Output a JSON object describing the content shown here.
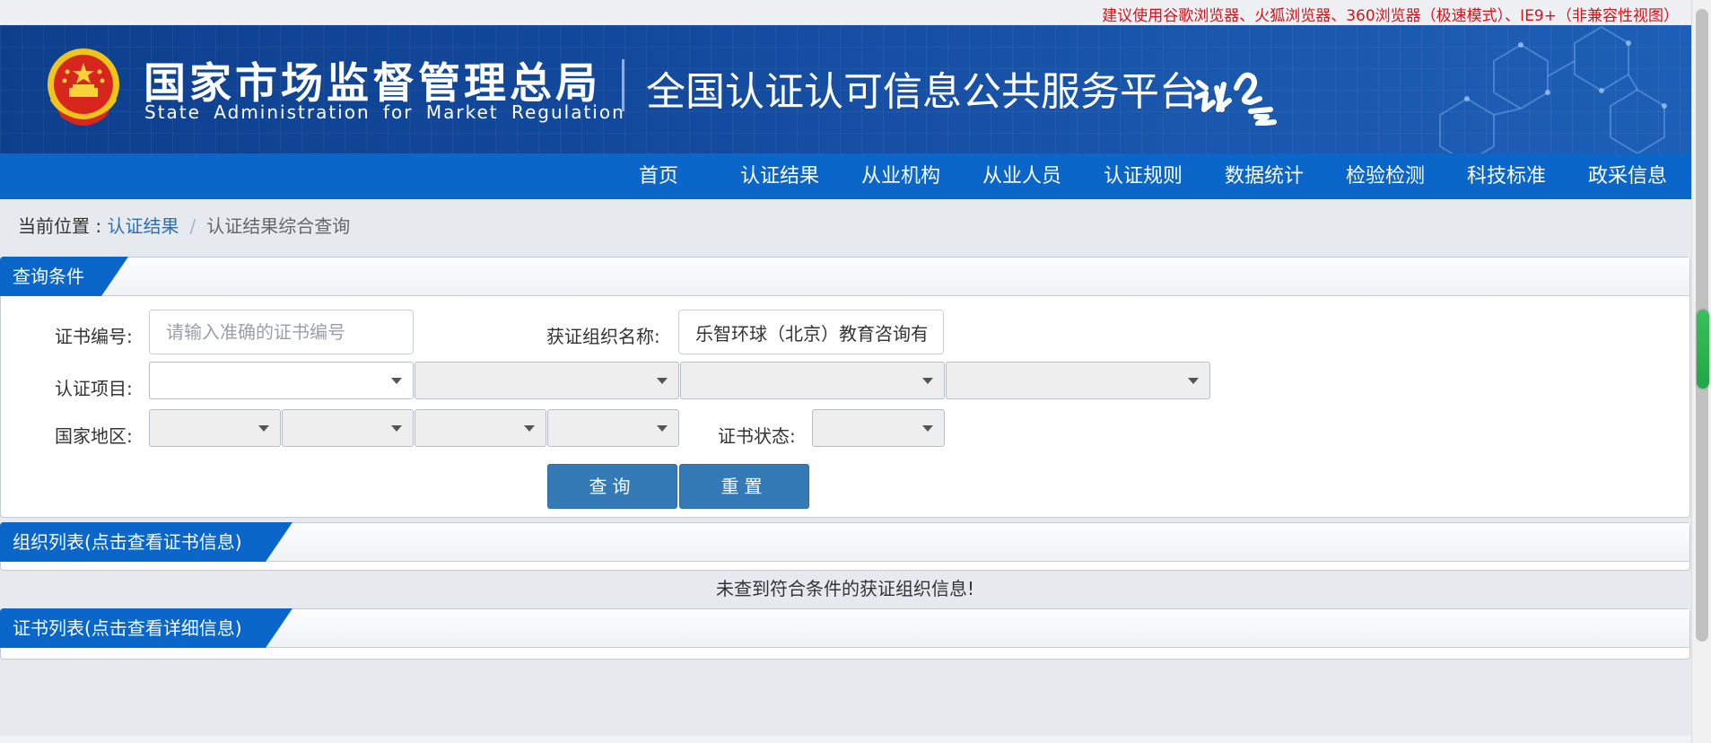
{
  "top_notice": "建议使用谷歌浏览器、火狐浏览器、360浏览器（极速模式）、IE9+（非兼容性视图）",
  "header": {
    "agency_cn": "国家市场监督管理总局",
    "agency_en": "State Administration  for  Market Regulation",
    "platform_title": "全国认证认可信息公共服务平台",
    "logo_icon": "renyun-cloud-logo",
    "emblem_icon": "national-emblem",
    "colors": {
      "banner": "#134a9e",
      "nav": "#0a66c8"
    }
  },
  "nav": {
    "items": [
      "首页",
      "认证结果",
      "从业机构",
      "从业人员",
      "认证规则",
      "数据统计",
      "检验检测",
      "科技标准",
      "政采信息"
    ]
  },
  "breadcrumb": {
    "prefix": "当前位置 : ",
    "link": "认证结果",
    "separator": "/",
    "current": "认证结果综合查询"
  },
  "query_panel": {
    "title": "查询条件",
    "cert_no_label": "证书编号:",
    "cert_no_placeholder": "请输入准确的证书编号",
    "cert_no_value": "",
    "org_name_label": "获证组织名称:",
    "org_name_value": "乐智环球（北京）教育咨询有限公司",
    "project_label": "认证项目:",
    "region_label": "国家地区:",
    "status_label": "证书状态:",
    "query_button": "查询",
    "reset_button": "重置"
  },
  "org_list": {
    "title": "组织列表(点击查看证书信息)",
    "empty_message": "未查到符合条件的获证组织信息!"
  },
  "cert_list": {
    "title": "证书列表(点击查看详细信息)"
  }
}
